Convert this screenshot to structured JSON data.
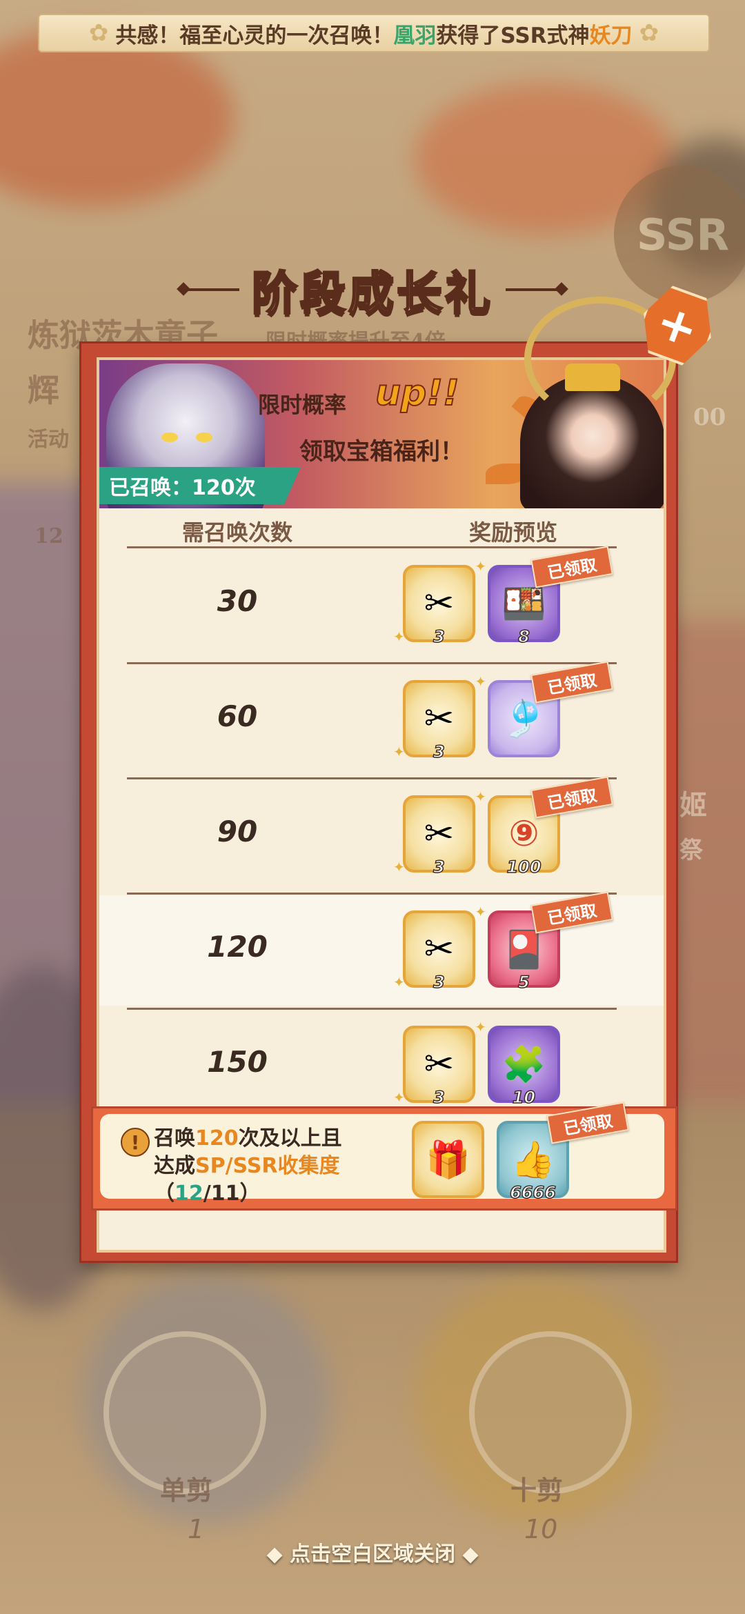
{
  "marquee": {
    "text_before": "共感！福至心灵的一次召唤！",
    "player": "凰羽",
    "text_middle": "获得了SSR式神",
    "shikigami": "妖刀"
  },
  "background": {
    "event_name_line1": "炼狱茨木童子",
    "event_sub": "限时概率提升至4倍",
    "event_name_line2": "辉",
    "event_activity": "活动",
    "ssr_badge": "SSR",
    "side_text_1": "姬",
    "side_text_2": "祭",
    "side_count": "12",
    "counter_right": "00",
    "btn_single_label": "单剪",
    "btn_single_num": "1",
    "btn_ten_label": "十剪",
    "btn_ten_num": "10"
  },
  "title": "阶段成长礼",
  "banner": {
    "line1_prefix": "限时概率",
    "line1_up": "up!!",
    "line2": "领取宝箱福利！",
    "summoned": "已召唤：120次"
  },
  "table": {
    "header_count": "需召唤次数",
    "header_rewards": "奖励预览",
    "rows": [
      {
        "count": "30",
        "reward1_qty": "3",
        "reward2_qty": "8",
        "reward2_claimed": "已领取"
      },
      {
        "count": "60",
        "reward1_qty": "3",
        "reward2_qty": "",
        "reward2_claimed": "已领取"
      },
      {
        "count": "90",
        "reward1_qty": "3",
        "reward2_qty": "100",
        "reward2_claimed": "已领取"
      },
      {
        "count": "120",
        "reward1_qty": "3",
        "reward2_qty": "5",
        "reward2_claimed": "已领取"
      },
      {
        "count": "150",
        "reward1_qty": "3",
        "reward2_qty": "10",
        "reward2_claimed": ""
      }
    ]
  },
  "bonus": {
    "line1_prefix": "召唤",
    "line1_num": "120",
    "line1_suffix": "次及以上且",
    "line2_prefix": "达成",
    "line2_hl": "SP/SSR收集度",
    "line3_open": "（",
    "line3_current": "12",
    "line3_sep": "/",
    "line3_total": "11",
    "line3_close": "）",
    "reward2_qty": "6666",
    "reward2_claimed": "已领取"
  },
  "close_hint": "◆ 点击空白区域关闭 ◆",
  "colors": {
    "panel_red": "#c44a33",
    "badge_green": "#2aa283",
    "claimed_orange": "#e0683a",
    "accent_orange": "#e8861f"
  }
}
